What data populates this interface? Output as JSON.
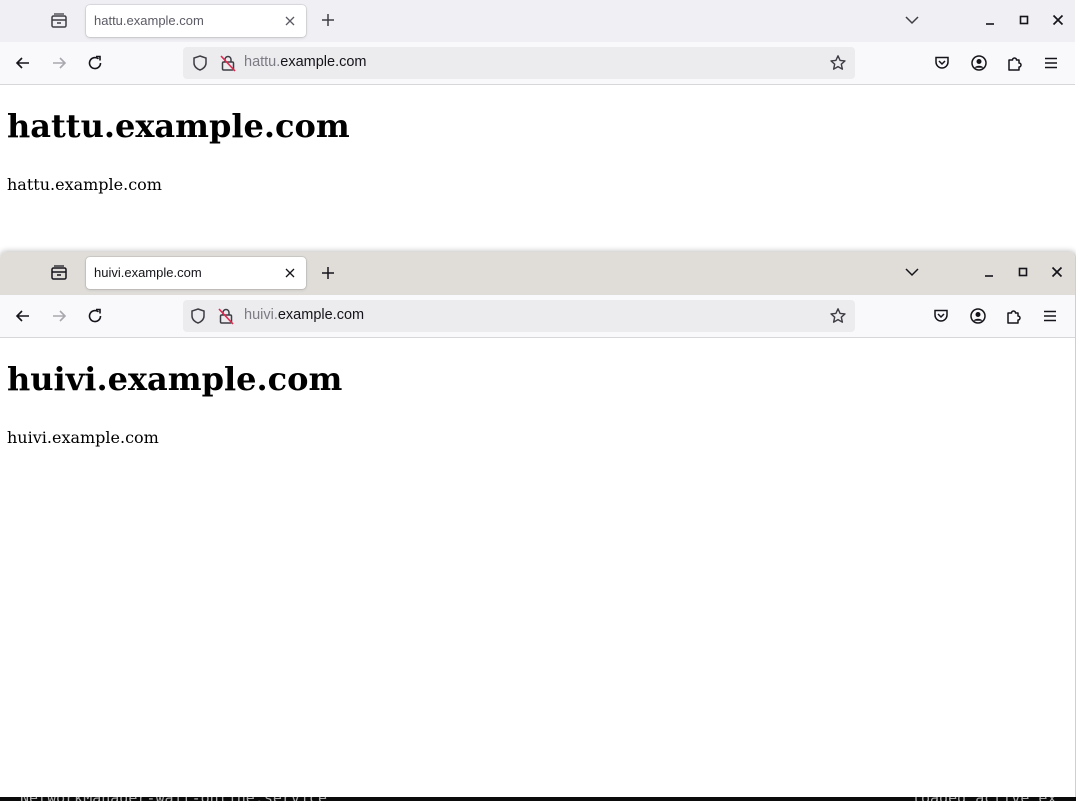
{
  "background_terminal": {
    "left_text": "NetworkManager-wait-online.service",
    "right_text": "loaded active ex"
  },
  "windows": [
    {
      "tab": {
        "title": "hattu.example.com"
      },
      "url": {
        "subdomain": "hattu.",
        "domain": "example.com"
      },
      "page": {
        "heading": "hattu.example.com",
        "text": "hattu.example.com"
      }
    },
    {
      "tab": {
        "title": "huivi.example.com"
      },
      "url": {
        "subdomain": "huivi.",
        "domain": "example.com"
      },
      "page": {
        "heading": "huivi.example.com",
        "text": "huivi.example.com"
      }
    }
  ],
  "colors": {
    "tabbar_inactive": "#f0f0f4",
    "tabbar_active": "#e0ddd9",
    "navbar": "#f9f9fb",
    "urlbar": "#ececee",
    "insecure_icon": "#e22850"
  }
}
